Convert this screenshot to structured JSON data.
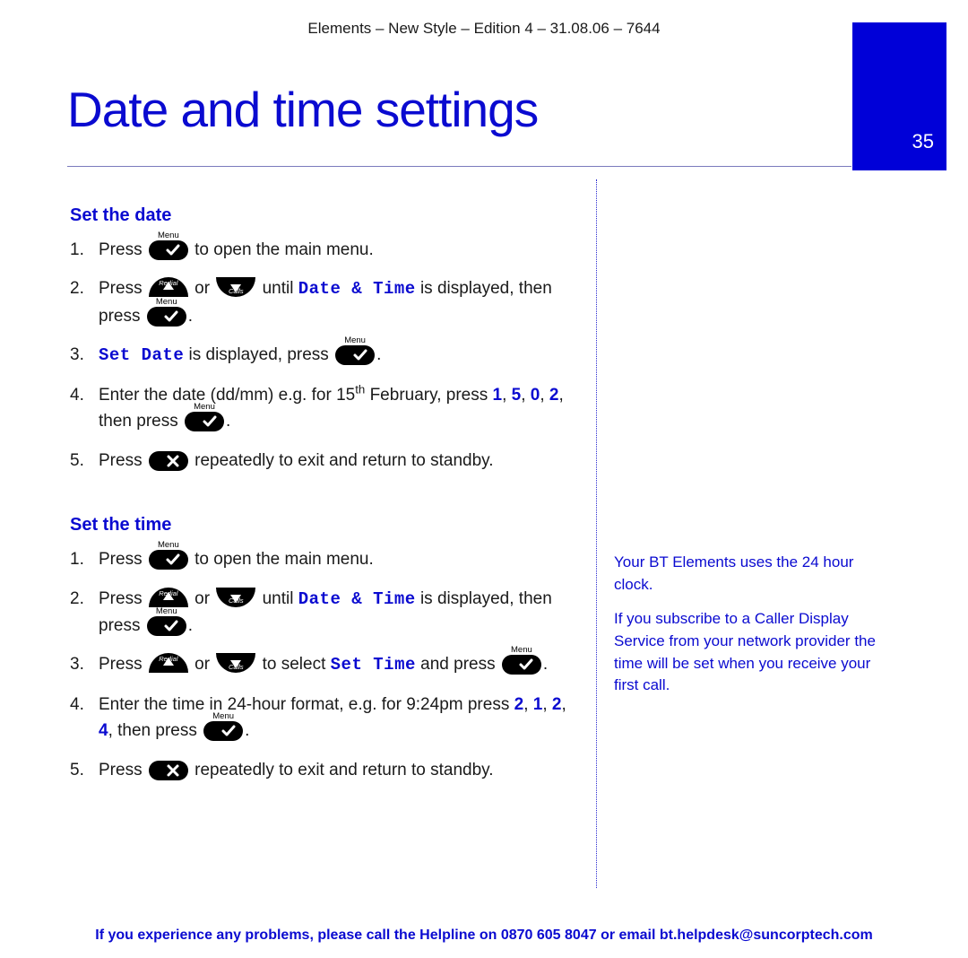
{
  "header": "Elements – New Style – Edition 4 – 31.08.06 – 7644",
  "page_number": "35",
  "title": "Date and time settings",
  "lcd": {
    "date_time": "Date & Time",
    "set_date": "Set Date",
    "set_time": "Set Time"
  },
  "word": {
    "press": "Press",
    "press_lower": "press",
    "to_open_main": " to open the main menu.",
    "or": " or ",
    "until": " until ",
    "is_displayed_then": " is displayed, then ",
    "period": ".",
    "is_displayed_press": " is displayed, press ",
    "enter_date_a": "Enter the date (dd/mm) e.g. for 15",
    "th": "th",
    "enter_date_b": " February, press ",
    "comma": ", ",
    "then_press": ", then press ",
    "repeat_exit": " repeatedly to exit and return to standby.",
    "to_select": " to select ",
    "and_press": " and press ",
    "enter_time_a": "Enter the time in 24-hour format, e.g. for 9:24pm press "
  },
  "digits": {
    "d1": "1",
    "d5": "5",
    "d0": "0",
    "d2": "2",
    "d4": "4"
  },
  "icon_label": {
    "menu": "Menu",
    "redial": "Redial",
    "calls": "Calls"
  },
  "sections": {
    "set_date": "Set the date",
    "set_time": "Set the time"
  },
  "sidebar": {
    "p1": "Your BT Elements uses the 24 hour clock.",
    "p2": "If you subscribe to a Caller Display Service from your network provider the time will be set when you receive your first call."
  },
  "footer": "If you experience any problems, please call the Helpline on 0870 605 8047 or email bt.helpdesk@suncorptech.com"
}
